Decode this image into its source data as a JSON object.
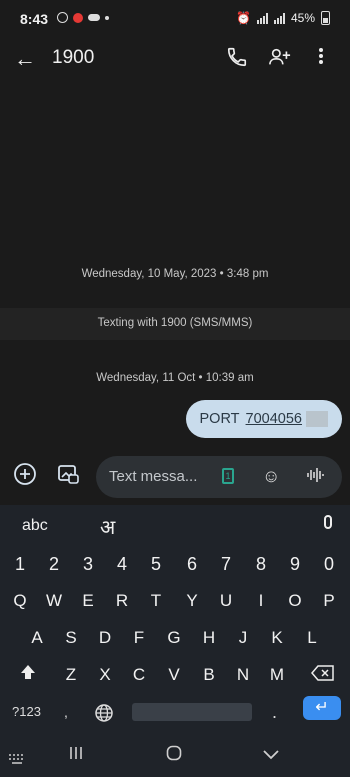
{
  "status": {
    "time": "8:43",
    "battery": "45%"
  },
  "header": {
    "back_icon": "arrow-left-icon",
    "title": "1900",
    "call_icon": "phone-icon",
    "add_contact_icon": "person-add-icon",
    "menu_icon": "more-vert-icon"
  },
  "conversation": {
    "date1": "Wednesday, 10 May, 2023 • 3:48 pm",
    "texting_with": "Texting with 1900 (SMS/MMS)",
    "date2": "Wednesday, 11 Oct • 10:39 am",
    "message_prefix": "PORT",
    "message_number": "7004056"
  },
  "composer": {
    "placeholder": "Text messa...",
    "sim_label": "1"
  },
  "keyboard": {
    "lang1": "abc",
    "lang2": "अ",
    "numbers": [
      "1",
      "2",
      "3",
      "4",
      "5",
      "6",
      "7",
      "8",
      "9",
      "0"
    ],
    "row1": [
      "Q",
      "W",
      "E",
      "R",
      "T",
      "Y",
      "U",
      "I",
      "O",
      "P"
    ],
    "row2": [
      "A",
      "S",
      "D",
      "F",
      "G",
      "H",
      "J",
      "K",
      "L"
    ],
    "row3": [
      "Z",
      "X",
      "C",
      "V",
      "B",
      "N",
      "M"
    ],
    "symbols": "?123",
    "comma": ",",
    "period": "."
  }
}
